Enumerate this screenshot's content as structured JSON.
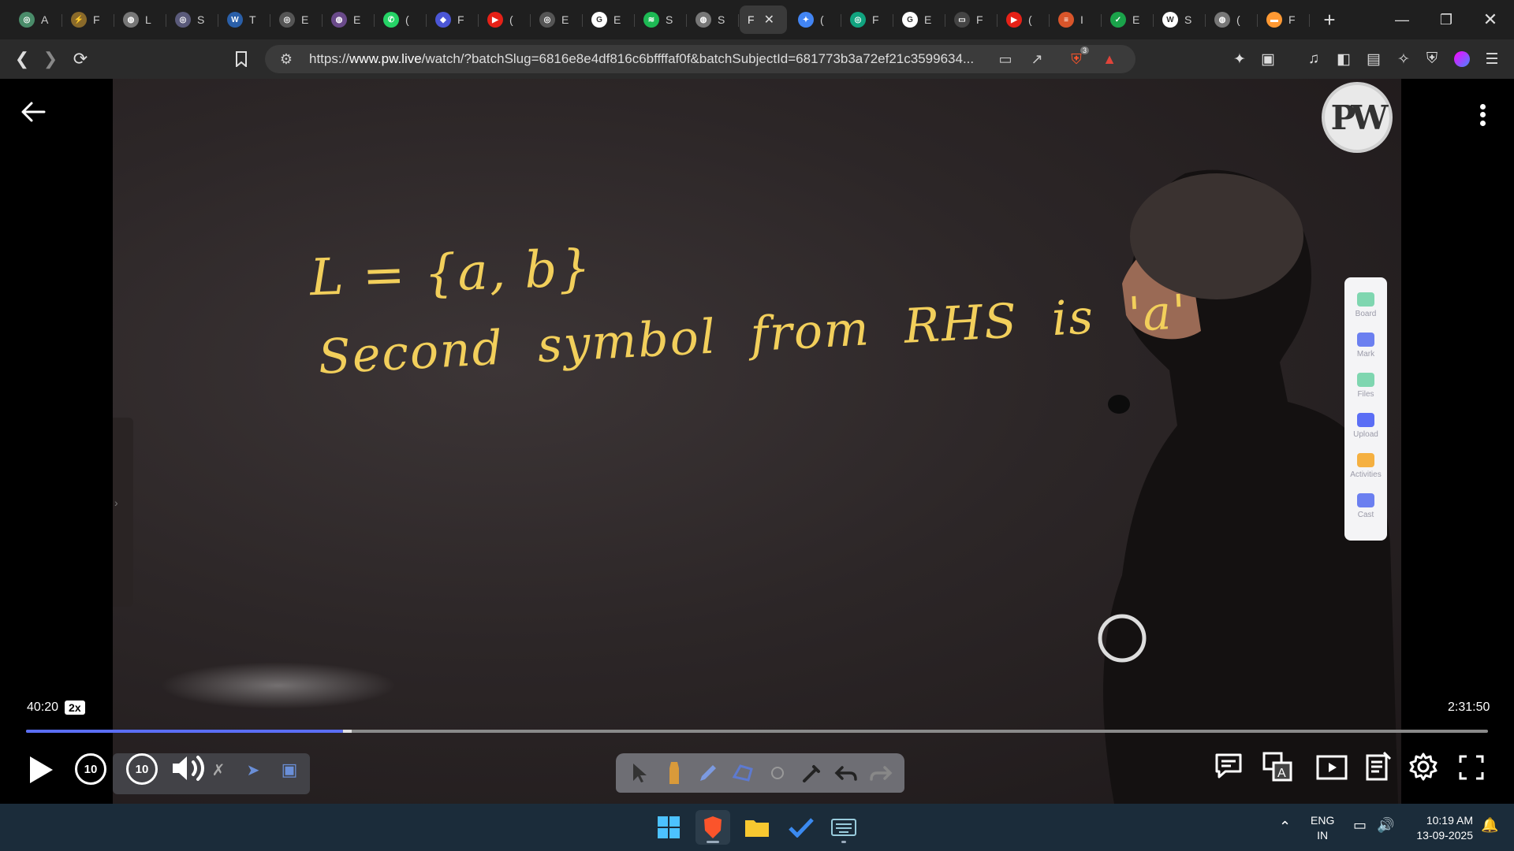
{
  "browser": {
    "tabs": [
      {
        "initial": "A",
        "color": "#4a8c6a",
        "glyph": "◎"
      },
      {
        "initial": "F",
        "color": "#8a6a2a",
        "glyph": "⚡"
      },
      {
        "initial": "L",
        "color": "#777777",
        "glyph": "◍"
      },
      {
        "initial": "S",
        "color": "#5a5a7a",
        "glyph": "◎"
      },
      {
        "initial": "T",
        "color": "#2a5fa8",
        "glyph": "W"
      },
      {
        "initial": "E",
        "color": "#555555",
        "glyph": "◎"
      },
      {
        "initial": "E",
        "color": "#6a4a8a",
        "glyph": "◍"
      },
      {
        "initial": "(",
        "color": "#25d366",
        "glyph": "✆"
      },
      {
        "initial": "F",
        "color": "#4b56d6",
        "glyph": "◆"
      },
      {
        "initial": "(",
        "color": "#e62117",
        "glyph": "▶"
      },
      {
        "initial": "E",
        "color": "#555555",
        "glyph": "◎"
      },
      {
        "initial": "E",
        "color": "#ffffff",
        "glyph": "G"
      },
      {
        "initial": "S",
        "color": "#1db954",
        "glyph": "≋"
      },
      {
        "initial": "S",
        "color": "#777777",
        "glyph": "◍"
      },
      {
        "initial": "F",
        "color": "#3a3a3a",
        "glyph": "",
        "active": true
      },
      {
        "initial": "(",
        "color": "#4285f4",
        "glyph": "✦"
      },
      {
        "initial": "F",
        "color": "#10a37f",
        "glyph": "◎"
      },
      {
        "initial": "E",
        "color": "#ffffff",
        "glyph": "G"
      },
      {
        "initial": "F",
        "color": "#444444",
        "glyph": "▭"
      },
      {
        "initial": "(",
        "color": "#e62117",
        "glyph": "▶"
      },
      {
        "initial": "I",
        "color": "#d9552a",
        "glyph": "≡"
      },
      {
        "initial": "E",
        "color": "#1aa34a",
        "glyph": "✓"
      },
      {
        "initial": "S",
        "color": "#ffffff",
        "glyph": "W"
      },
      {
        "initial": "(",
        "color": "#777777",
        "glyph": "◍"
      },
      {
        "initial": "F",
        "color": "#ff9933",
        "glyph": "▬"
      }
    ],
    "active_tab_close": "✕",
    "new_tab": "+",
    "url_prefix": "https://",
    "url_host": "www.pw.live",
    "url_path": "/watch/?batchSlug=6816e8e4df816c6bffffaf0f&batchSubjectId=681773b3a72ef21c3599634...",
    "brave_shield_count": "3"
  },
  "player": {
    "board_line1": "L = {a, b}",
    "board_line2": "Second symbol from RHS is 'a'",
    "logo_text": "PW",
    "current_time": "40:20",
    "speed": "2x",
    "total_time": "2:31:50",
    "progress_fraction": 0.217,
    "buffer_fraction": 0.006,
    "skip_back": "10",
    "skip_forward": "10",
    "side_panel": [
      {
        "label": "Board",
        "color": "#7fd6b0"
      },
      {
        "label": "Mark",
        "color": "#6b7ff0"
      },
      {
        "label": "Files",
        "color": "#7fd6b0"
      },
      {
        "label": "Upload",
        "color": "#5b6ef5"
      },
      {
        "label": "Activities",
        "color": "#f5b041"
      },
      {
        "label": "Cast",
        "color": "#6b7ff0"
      }
    ]
  },
  "taskbar": {
    "lang_line1": "ENG",
    "lang_line2": "IN",
    "time": "10:19 AM",
    "date": "13-09-2025"
  }
}
